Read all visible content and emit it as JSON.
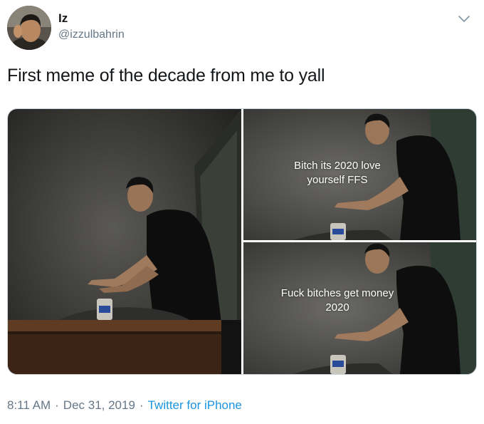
{
  "user": {
    "display_name": "Iz",
    "handle": "@izzulbahrin"
  },
  "tweet": {
    "text": "First meme of the decade from me to yall"
  },
  "media": {
    "caption_top": "Bitch its 2020 love yourself FFS",
    "caption_bottom": "Fuck bitches get money 2020"
  },
  "meta": {
    "time": "8:11 AM",
    "separator": "·",
    "date": "Dec 31, 2019",
    "source": "Twitter for iPhone"
  },
  "colors": {
    "text": "#14171a",
    "secondary": "#657786",
    "link": "#1b95e0"
  },
  "icons": {
    "more": "chevron-down-icon"
  }
}
